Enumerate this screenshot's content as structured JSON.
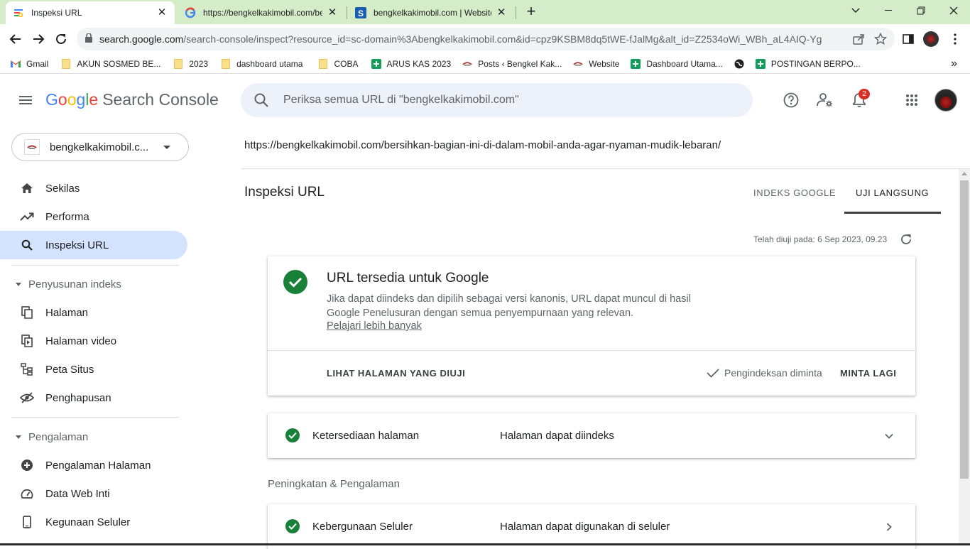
{
  "browser": {
    "tabs": [
      {
        "title": "Inspeksi URL",
        "icon": "search-console-icon",
        "active": true
      },
      {
        "title": "https://bengkelkakimobil.com/be",
        "icon": "google-icon",
        "active": false
      },
      {
        "title": "bengkelkakimobil.com | Website",
        "icon": "site-s-icon",
        "active": false
      }
    ],
    "new_tab": "+",
    "address_host": "search.google.com",
    "address_path": "/search-console/inspect?resource_id=sc-domain%3Abengkelkakimobil.com&id=cpz9KSBM8dq5tWE-fJalMg&alt_id=Z2534oWi_WBh_aL4AIQ-Yg",
    "bookmarks": [
      {
        "label": "Gmail",
        "icon": "gmail-icon"
      },
      {
        "label": "AKUN SOSMED BE...",
        "icon": "folder-icon"
      },
      {
        "label": "2023",
        "icon": "folder-icon"
      },
      {
        "label": "dashboard utama",
        "icon": "folder-icon"
      },
      {
        "label": "COBA",
        "icon": "folder-icon"
      },
      {
        "label": "ARUS KAS 2023",
        "icon": "sheets-icon"
      },
      {
        "label": "Posts ‹ Bengkel Kak...",
        "icon": "site-icon"
      },
      {
        "label": "Website",
        "icon": "site-icon"
      },
      {
        "label": "Dashboard Utama...",
        "icon": "sheets-icon"
      },
      {
        "label": "",
        "icon": "globe-icon"
      },
      {
        "label": "POSTINGAN BERPO...",
        "icon": "sheets-icon"
      }
    ],
    "more_bookmarks": "»"
  },
  "header": {
    "logo_google": [
      "G",
      "o",
      "o",
      "g",
      "l",
      "e"
    ],
    "product": "Search Console",
    "search_placeholder": "Periksa semua URL di \"bengkelkakimobil.com\"",
    "notification_count": "2"
  },
  "sidebar": {
    "property": "bengkelkakimobil.c...",
    "items_top": [
      {
        "label": "Sekilas",
        "icon": "home-icon"
      },
      {
        "label": "Performa",
        "icon": "trending-icon"
      },
      {
        "label": "Inspeksi URL",
        "icon": "search-icon",
        "active": true
      }
    ],
    "section_index": "Penyusunan indeks",
    "items_index": [
      {
        "label": "Halaman",
        "icon": "pages-icon"
      },
      {
        "label": "Halaman video",
        "icon": "video-page-icon"
      },
      {
        "label": "Peta Situs",
        "icon": "sitemap-icon"
      },
      {
        "label": "Penghapusan",
        "icon": "removal-icon"
      }
    ],
    "section_experience": "Pengalaman",
    "items_experience": [
      {
        "label": "Pengalaman Halaman",
        "icon": "plus-circle-icon"
      },
      {
        "label": "Data Web Inti",
        "icon": "gauge-icon"
      },
      {
        "label": "Kegunaan Seluler",
        "icon": "phone-icon"
      }
    ]
  },
  "main": {
    "inspected_url": "https://bengkelkakimobil.com/bersihkan-bagian-ini-di-dalam-mobil-anda-agar-nyaman-mudik-lebaran/",
    "title": "Inspeksi URL",
    "tabs": [
      {
        "label": "INDEKS GOOGLE",
        "active": false
      },
      {
        "label": "UJI LANGSUNG",
        "active": true
      }
    ],
    "tested_on": "Telah diuji pada: 6 Sep 2023, 09.23",
    "status_card": {
      "title": "URL tersedia untuk Google",
      "description": "Jika dapat diindeks dan dipilih sebagai versi kanonis, URL dapat muncul di hasil Google Penelusuran dengan semua penyempurnaan yang relevan.",
      "learn_more": "Pelajari lebih banyak",
      "view_tested_page": "LIHAT HALAMAN YANG DIUJI",
      "indexing_requested": "Pengindeksan diminta",
      "request_again": "MINTA LAGI"
    },
    "availability": {
      "label": "Ketersediaan halaman",
      "value": "Halaman dapat diindeks"
    },
    "enhancements_heading": "Peningkatan & Pengalaman",
    "mobile": {
      "label": "Kebergunaan Seluler",
      "value": "Halaman dapat digunakan di seluler"
    }
  },
  "colors": {
    "success_green": "#188038",
    "active_nav_bg": "#d3e3fd",
    "tab_strip": "#d4ecc7"
  }
}
